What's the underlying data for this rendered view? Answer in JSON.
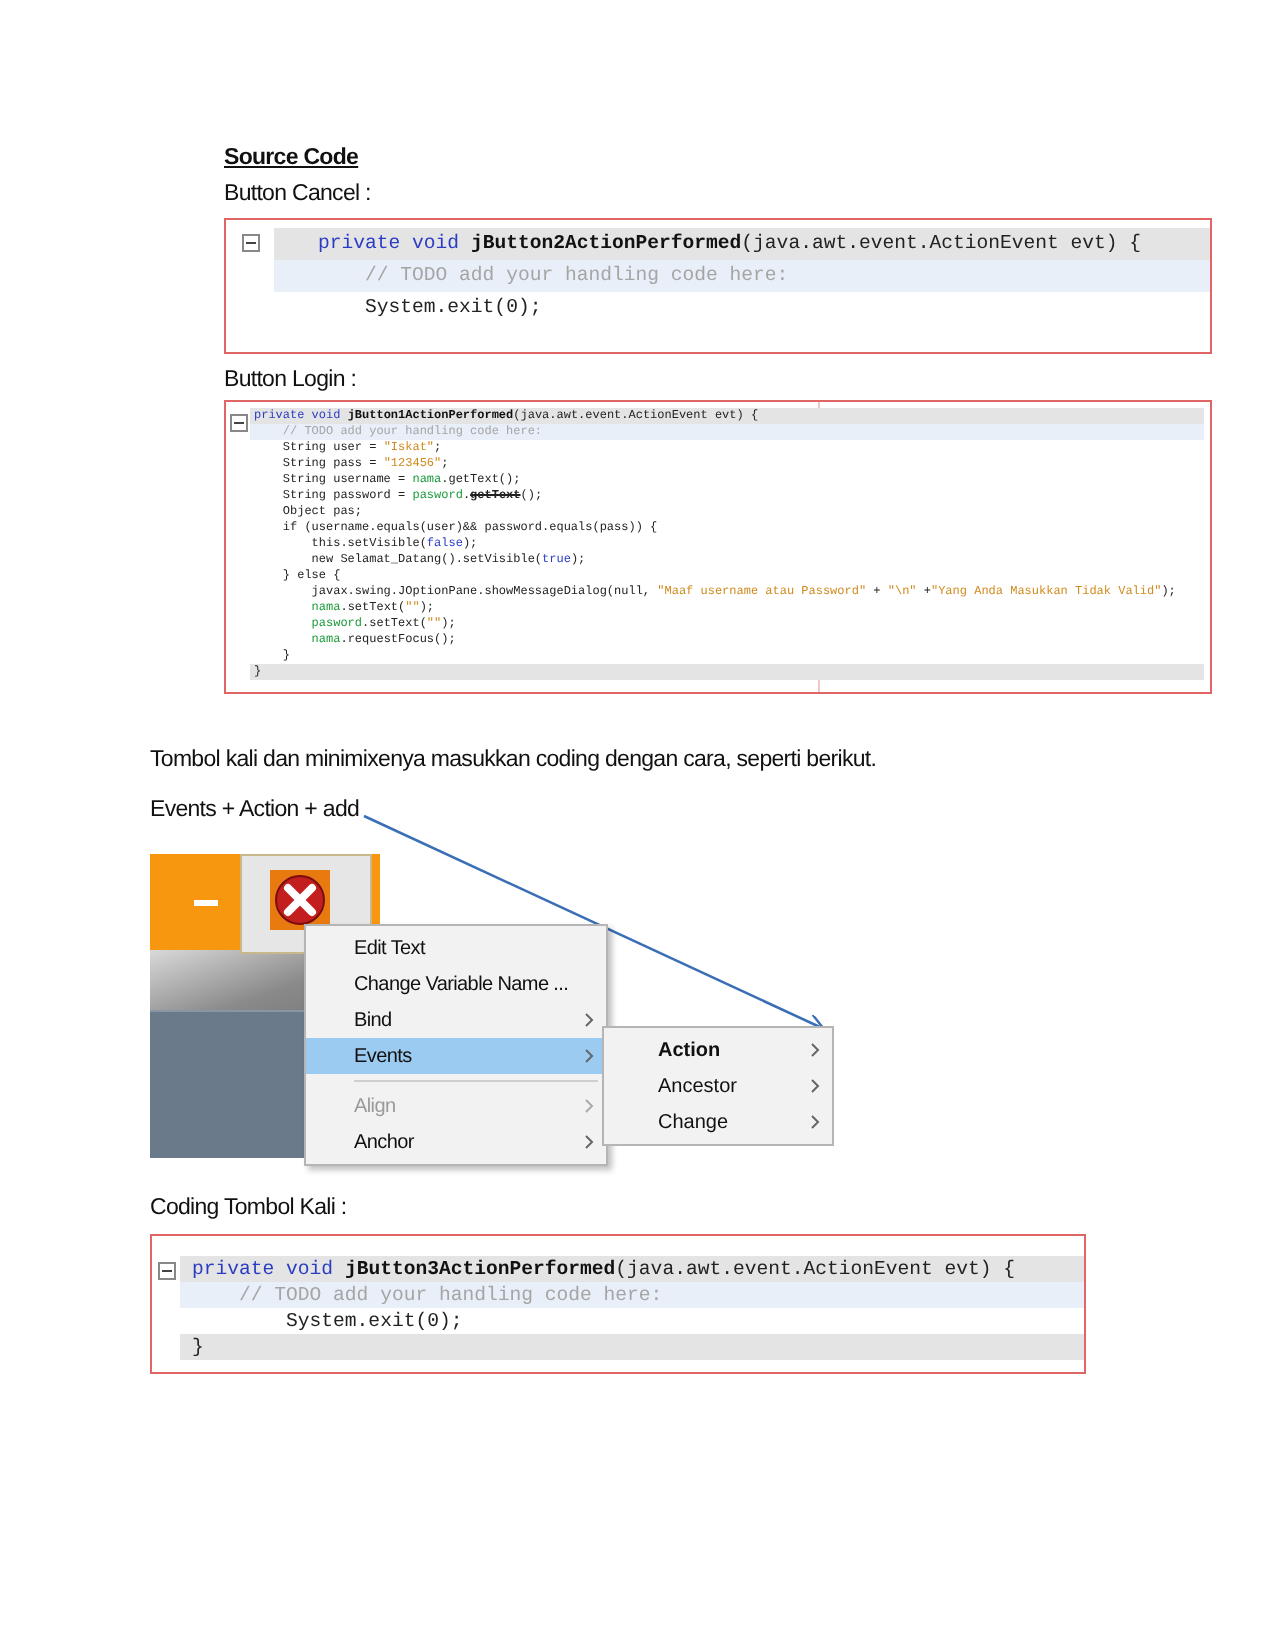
{
  "heading": "Source Code",
  "cancel": {
    "label": "Button Cancel :",
    "lines": [
      {
        "kind": "header",
        "segments": [
          {
            "kind": "kw",
            "text": "private void "
          },
          {
            "kind": "method",
            "text": "jButton2ActionPerformed"
          },
          {
            "kind": "plain",
            "text": "(java.awt.event.ActionEvent evt) {"
          }
        ]
      },
      {
        "kind": "current",
        "segments": [
          {
            "kind": "comment",
            "text": "    // TODO add your handling code here:"
          }
        ]
      },
      {
        "kind": "plain",
        "segments": [
          {
            "kind": "plain",
            "text": "    System.exit(0);"
          }
        ]
      }
    ]
  },
  "login": {
    "label": "Button Login :",
    "lines": [
      {
        "kind": "header",
        "segments": [
          {
            "kind": "kw",
            "text": "private void "
          },
          {
            "kind": "method",
            "text": "jButton1ActionPerformed"
          },
          {
            "kind": "plain",
            "text": "(java.awt.event.ActionEvent evt) {"
          }
        ]
      },
      {
        "kind": "current",
        "segments": [
          {
            "kind": "comment",
            "text": "    // TODO add your handling code here:"
          }
        ]
      },
      {
        "kind": "plain",
        "segments": [
          {
            "kind": "plain",
            "text": "    String user = "
          },
          {
            "kind": "str",
            "text": "\"Iskat\""
          },
          {
            "kind": "plain",
            "text": ";"
          }
        ]
      },
      {
        "kind": "plain",
        "segments": [
          {
            "kind": "plain",
            "text": "    String pass = "
          },
          {
            "kind": "str",
            "text": "\"123456\""
          },
          {
            "kind": "plain",
            "text": ";"
          }
        ]
      },
      {
        "kind": "plain",
        "segments": [
          {
            "kind": "plain",
            "text": "    String username = "
          },
          {
            "kind": "field",
            "text": "nama"
          },
          {
            "kind": "plain",
            "text": ".getText();"
          }
        ]
      },
      {
        "kind": "plain",
        "segments": [
          {
            "kind": "plain",
            "text": "    String password = "
          },
          {
            "kind": "field",
            "text": "pasword"
          },
          {
            "kind": "plain",
            "text": "."
          },
          {
            "kind": "deprecated",
            "text": "getText"
          },
          {
            "kind": "plain",
            "text": "();"
          }
        ]
      },
      {
        "kind": "plain",
        "segments": [
          {
            "kind": "plain",
            "text": "    Object pas;"
          }
        ]
      },
      {
        "kind": "plain",
        "segments": [
          {
            "kind": "plain",
            "text": "    if (username.equals(user)&& password.equals(pass)) {"
          }
        ]
      },
      {
        "kind": "plain",
        "segments": [
          {
            "kind": "plain",
            "text": "        this.setVisible("
          },
          {
            "kind": "kw",
            "text": "false"
          },
          {
            "kind": "plain",
            "text": ");"
          }
        ]
      },
      {
        "kind": "plain",
        "segments": [
          {
            "kind": "plain",
            "text": "        new Selamat_Datang().setVisible("
          },
          {
            "kind": "kw",
            "text": "true"
          },
          {
            "kind": "plain",
            "text": ");"
          }
        ]
      },
      {
        "kind": "plain",
        "segments": [
          {
            "kind": "plain",
            "text": "    } else {"
          }
        ]
      },
      {
        "kind": "plain",
        "segments": [
          {
            "kind": "plain",
            "text": "        javax.swing.JOptionPane.showMessageDialog(null, "
          },
          {
            "kind": "str",
            "text": "\"Maaf username atau Password\""
          },
          {
            "kind": "plain",
            "text": " + "
          },
          {
            "kind": "str",
            "text": "\"\\n\""
          },
          {
            "kind": "plain",
            "text": " +"
          },
          {
            "kind": "str",
            "text": "\"Yang Anda Masukkan Tidak Valid\""
          },
          {
            "kind": "plain",
            "text": ");"
          }
        ]
      },
      {
        "kind": "plain",
        "segments": [
          {
            "kind": "field",
            "text": "        nama"
          },
          {
            "kind": "plain",
            "text": ".setText("
          },
          {
            "kind": "str",
            "text": "\"\""
          },
          {
            "kind": "plain",
            "text": ");"
          }
        ]
      },
      {
        "kind": "plain",
        "segments": [
          {
            "kind": "field",
            "text": "        pasword"
          },
          {
            "kind": "plain",
            "text": ".setText("
          },
          {
            "kind": "str",
            "text": "\"\""
          },
          {
            "kind": "plain",
            "text": ");"
          }
        ]
      },
      {
        "kind": "plain",
        "segments": [
          {
            "kind": "field",
            "text": "        nama"
          },
          {
            "kind": "plain",
            "text": ".requestFocus();"
          }
        ]
      },
      {
        "kind": "plain",
        "segments": [
          {
            "kind": "plain",
            "text": "    }"
          }
        ]
      },
      {
        "kind": "footer",
        "segments": [
          {
            "kind": "plain",
            "text": "}"
          }
        ]
      }
    ]
  },
  "paragraph": "Tombol kali dan minimixenya masukkan coding dengan cara, seperti berikut.",
  "steps": "Events + Action + add",
  "menu": [
    {
      "kind": "item",
      "label": "Edit Text",
      "selected": false,
      "disabled": false,
      "submenu": false
    },
    {
      "kind": "item",
      "label": "Change Variable Name ...",
      "selected": false,
      "disabled": false,
      "submenu": false
    },
    {
      "kind": "item",
      "label": "Bind",
      "selected": false,
      "disabled": false,
      "submenu": true
    },
    {
      "kind": "item",
      "label": "Events",
      "selected": true,
      "disabled": false,
      "submenu": true
    },
    {
      "kind": "separator"
    },
    {
      "kind": "item",
      "label": "Align",
      "selected": false,
      "disabled": true,
      "submenu": true
    },
    {
      "kind": "item",
      "label": "Anchor",
      "selected": false,
      "disabled": false,
      "submenu": true
    }
  ],
  "submenu": [
    {
      "label": "Action",
      "bold": true
    },
    {
      "label": "Ancestor",
      "bold": false
    },
    {
      "label": "Change",
      "bold": false
    }
  ],
  "kali": {
    "label": "Coding Tombol Kali :",
    "lines": [
      {
        "kind": "header",
        "segments": [
          {
            "kind": "kw",
            "text": "private void "
          },
          {
            "kind": "method",
            "text": "jButton3ActionPerformed"
          },
          {
            "kind": "plain",
            "text": "(java.awt.event.ActionEvent evt) {"
          }
        ]
      },
      {
        "kind": "current",
        "segments": [
          {
            "kind": "comment",
            "text": "    // TODO add your handling code here:"
          }
        ]
      },
      {
        "kind": "plain",
        "segments": [
          {
            "kind": "plain",
            "text": "        System.exit(0);"
          }
        ]
      },
      {
        "kind": "footer",
        "segments": [
          {
            "kind": "plain",
            "text": "}"
          }
        ]
      }
    ]
  }
}
